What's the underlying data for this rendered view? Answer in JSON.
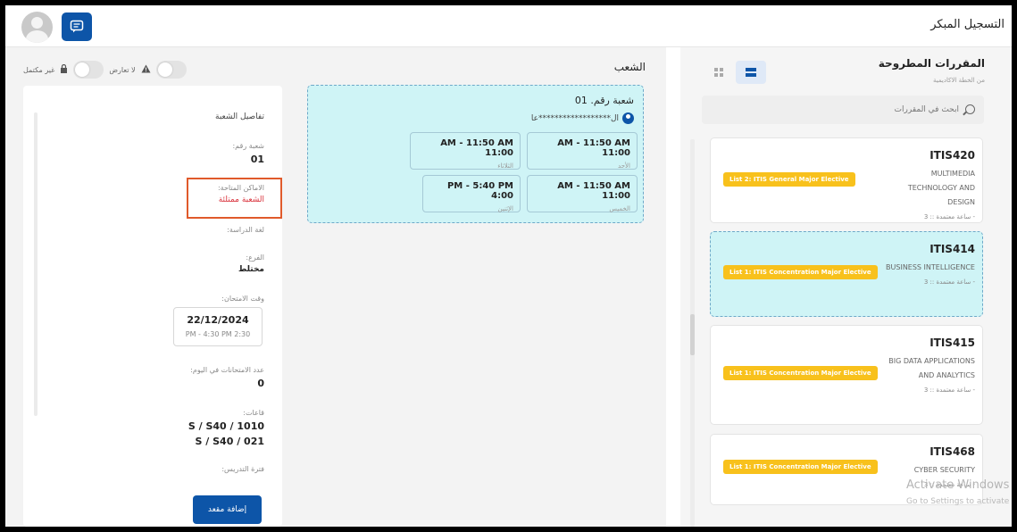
{
  "header": {
    "title": "التسجيل المبكر"
  },
  "toggles": {
    "no_conflict_label": "لا تعارض",
    "not_full_label": "غير مكتمل"
  },
  "sections": {
    "title": "الشعب",
    "card": {
      "title": "شعبة رقم. 01",
      "instructor": "ال******************عا",
      "slots": [
        {
          "time": "AM - 11:50 AM 11:00",
          "day": "الأحد"
        },
        {
          "time": "AM - 11:50 AM 11:00",
          "day": "الثلاثاء"
        },
        {
          "time": "AM - 11:50 AM 11:00",
          "day": "الخميس"
        },
        {
          "time": "PM - 5:40 PM 4:00",
          "day": "الإثنين"
        }
      ]
    }
  },
  "details": {
    "heading": "تفاصيل الشعبة",
    "section_number_label": "شعبة رقم:",
    "section_number_value": "01",
    "available_seats_label": "الاماكن المتاحة:",
    "available_seats_value": "الشعبة ممتلئة",
    "study_language_label": "لغة الدراسة:",
    "gender_label": "الفرع:",
    "gender_value": "مختلط",
    "exam_time_label": "وقت الامتحان:",
    "exam_date": "22/12/2024",
    "exam_time": "PM - 4:30 PM 2:30",
    "exams_per_day_label": "عدد الامتحانات في اليوم:",
    "exams_per_day_value": "0",
    "rooms_label": "قاعات:",
    "rooms": [
      "S / S40 / 1010",
      "S / S40 / 021"
    ],
    "period_label": "فترة التدريس:",
    "add_button": "إضافة مقعد"
  },
  "courses": {
    "title": "المقررات المطروحة",
    "subtitle": "من الخطة الاكاديمية",
    "search_placeholder": "ابحث في المقررات",
    "items": [
      {
        "code": "ITIS420",
        "name": "MULTIMEDIA TECHNOLOGY AND DESIGN",
        "credits": "- ساعة معتمدة :: 3",
        "badge": "List 2: ITIS General Major Elective"
      },
      {
        "code": "ITIS414",
        "name": "BUSINESS INTELLIGENCE",
        "credits": "- ساعة معتمدة :: 3",
        "badge": "List 1: ITIS Concentration Major Elective"
      },
      {
        "code": "ITIS415",
        "name": "BIG DATA APPLICATIONS AND ANALYTICS",
        "credits": "- ساعة معتمدة :: 3",
        "badge": "List 1: ITIS Concentration Major Elective"
      },
      {
        "code": "ITIS468",
        "name": "CYBER SECURITY",
        "credits": "- ساعة معتمدة :: 3",
        "badge": "List 1: ITIS Concentration Major Elective"
      }
    ]
  },
  "watermark": {
    "line1": "Activate Windows",
    "line2": "Go to Settings to activate Windows."
  },
  "colors": {
    "primary": "#0d55a8",
    "selected_bg": "#cff4f6",
    "badge": "#f8c11c",
    "alert": "#d9303a"
  }
}
